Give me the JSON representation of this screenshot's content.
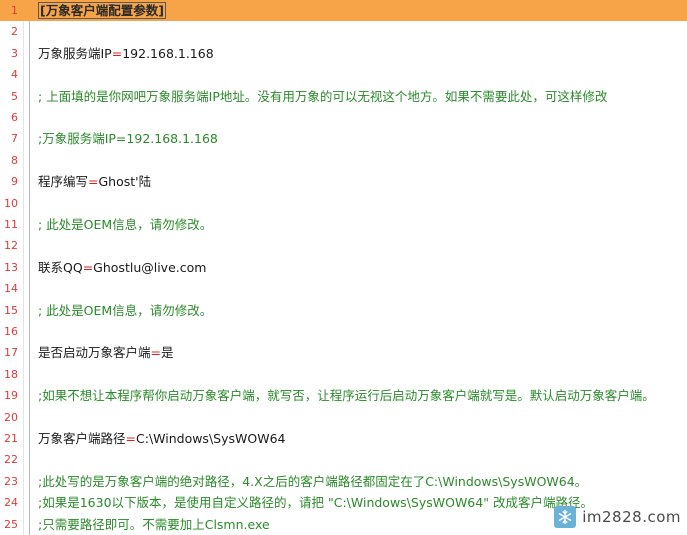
{
  "lines": [
    {
      "n": "1",
      "kind": "section",
      "text": "[万象客户端配置参数]",
      "current": true
    },
    {
      "n": "2",
      "kind": "blank",
      "text": ""
    },
    {
      "n": "3",
      "kind": "kv",
      "key": "万象服务端IP",
      "value": "192.168.1.168"
    },
    {
      "n": "4",
      "kind": "blank",
      "text": ""
    },
    {
      "n": "5",
      "kind": "comment",
      "text": "; 上面填的是你网吧万象服务端IP地址。没有用万象的可以无视这个地方。如果不需要此处，可这样修改"
    },
    {
      "n": "6",
      "kind": "blank",
      "text": ""
    },
    {
      "n": "7",
      "kind": "comment",
      "text": ";万象服务端IP=192.168.1.168"
    },
    {
      "n": "8",
      "kind": "blank",
      "text": ""
    },
    {
      "n": "9",
      "kind": "kv",
      "key": "程序编写",
      "value": "Ghost'陆"
    },
    {
      "n": "10",
      "kind": "blank",
      "text": ""
    },
    {
      "n": "11",
      "kind": "comment",
      "text": "; 此处是OEM信息，请勿修改。"
    },
    {
      "n": "12",
      "kind": "blank",
      "text": ""
    },
    {
      "n": "13",
      "kind": "kv",
      "key": "联系QQ",
      "value": "Ghostlu@live.com"
    },
    {
      "n": "14",
      "kind": "blank",
      "text": ""
    },
    {
      "n": "15",
      "kind": "comment",
      "text": "; 此处是OEM信息，请勿修改。"
    },
    {
      "n": "16",
      "kind": "blank",
      "text": ""
    },
    {
      "n": "17",
      "kind": "kv",
      "key": "是否启动万象客户端",
      "value": "是"
    },
    {
      "n": "18",
      "kind": "blank",
      "text": ""
    },
    {
      "n": "19",
      "kind": "comment",
      "text": ";如果不想让本程序帮你启动万象客户端，就写否，让程序运行后启动万象客户端就写是。默认启动万象客户端。"
    },
    {
      "n": "20",
      "kind": "blank",
      "text": ""
    },
    {
      "n": "21",
      "kind": "kv",
      "key": "万象客户端路径",
      "value": "C:\\Windows\\SysWOW64"
    },
    {
      "n": "22",
      "kind": "blank",
      "text": ""
    },
    {
      "n": "23",
      "kind": "comment",
      "text": ";此处写的是万象客户端的绝对路径，4.X之后的客户端路径都固定在了C:\\Windows\\SysWOW64。"
    },
    {
      "n": "24",
      "kind": "comment",
      "text": ";如果是1630以下版本，是使用自定义路径的，请把 \"C:\\Windows\\SysWOW64\" 改成客户端路径。"
    },
    {
      "n": "25",
      "kind": "comment",
      "text": ";只需要路径即可。不需要加上Clsmn.exe"
    }
  ],
  "operator": "=",
  "watermark": {
    "text": "im2828.com",
    "icon": "snowflake-icon"
  },
  "colors": {
    "line_number": "#e03a3a",
    "comment": "#2a8a2a",
    "operator": "#e02020",
    "current_line": "#f7a348",
    "watermark_logo": "#6ab3d7"
  }
}
